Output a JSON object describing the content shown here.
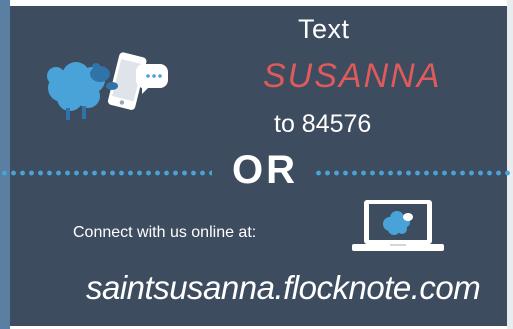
{
  "promo": {
    "line_text": "Text",
    "keyword": "SUSANNA",
    "line_number": "to 84576",
    "divider": "OR",
    "connect_label": "Connect with us online at:",
    "url": "saintsusanna.flocknote.com"
  },
  "icons": {
    "phone": "sheep-with-phone-icon",
    "laptop": "laptop-with-sheep-icon"
  },
  "colors": {
    "background": "#3d4c5f",
    "keyword": "#df5b5b",
    "accent_blue": "#4aa3d8",
    "text": "#ffffff"
  }
}
